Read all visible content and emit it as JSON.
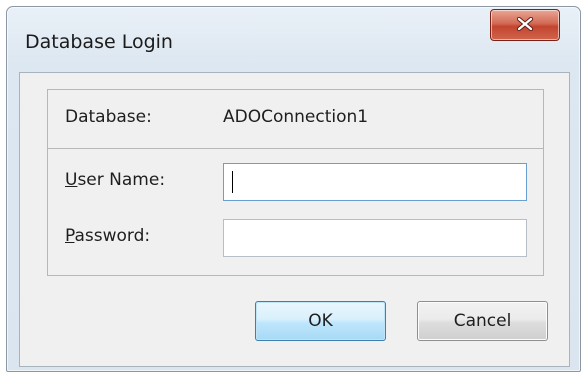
{
  "window": {
    "title": "Database Login",
    "close_icon": "close-x-icon"
  },
  "form": {
    "database_label": "Database:",
    "database_value": "ADOConnection1",
    "user_name_label_mnemonic": "U",
    "user_name_label_rest": "ser Name:",
    "user_name_value": "",
    "password_label_mnemonic": "P",
    "password_label_rest": "assword:",
    "password_value": ""
  },
  "buttons": {
    "ok_label": "OK",
    "cancel_label": "Cancel"
  },
  "colors": {
    "close_button": "#c3452f",
    "ok_button": "#bee6fd",
    "focus_border": "#6a9fd4"
  }
}
